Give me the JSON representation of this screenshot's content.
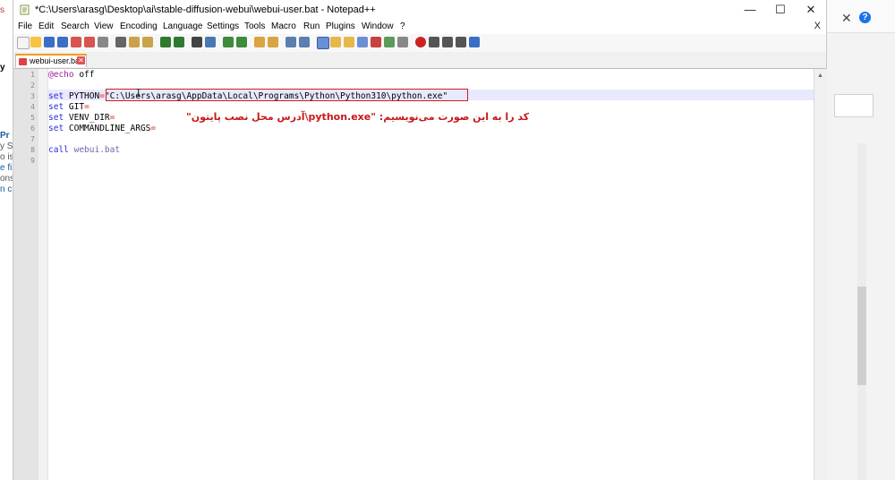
{
  "window": {
    "title": "*C:\\Users\\arasg\\Desktop\\ai\\stable-diffusion-webui\\webui-user.bat - Notepad++",
    "minimize": "—",
    "maximize": "☐",
    "close": "✕"
  },
  "menu": {
    "items": [
      "File",
      "Edit",
      "Search",
      "View",
      "Encoding",
      "Language",
      "Settings",
      "Tools",
      "Macro",
      "Run",
      "Plugins",
      "Window",
      "?"
    ],
    "close": "X"
  },
  "tab": {
    "label": "webui-user.bat",
    "close": "✕"
  },
  "editor": {
    "line_numbers": [
      "1",
      "2",
      "3",
      "4",
      "5",
      "6",
      "7",
      "8",
      "9"
    ],
    "lines": {
      "l1_kw": "@echo",
      "l1_rest": " off",
      "l3_kw": "set",
      "l3_var": " PYTHON",
      "l3_eq": "=",
      "l3_val": "\"C:\\Users\\arasg\\AppData\\Local\\Programs\\Python\\Python310\\python.exe\"",
      "l4_kw": "set",
      "l4_var": " GIT",
      "l4_eq": "=",
      "l5_kw": "set",
      "l5_var": " VENV_DIR",
      "l5_eq": "=",
      "l6_kw": "set",
      "l6_var": " COMMANDLINE_ARGS",
      "l6_eq": "=",
      "l8_kw": "call",
      "l8_rest": " webui.bat"
    }
  },
  "annotations": {
    "line1": "کد را به این صورت می‌نویسیم:   \"python.exe\\آدرس محل نصب پایتون\""
  },
  "background": {
    "left_fragments": [
      "s",
      "y",
      "Pr",
      "y Sc",
      "o is",
      "e fi",
      "ons",
      "n c"
    ],
    "close_mark": "✕",
    "help_glyph": "?"
  }
}
